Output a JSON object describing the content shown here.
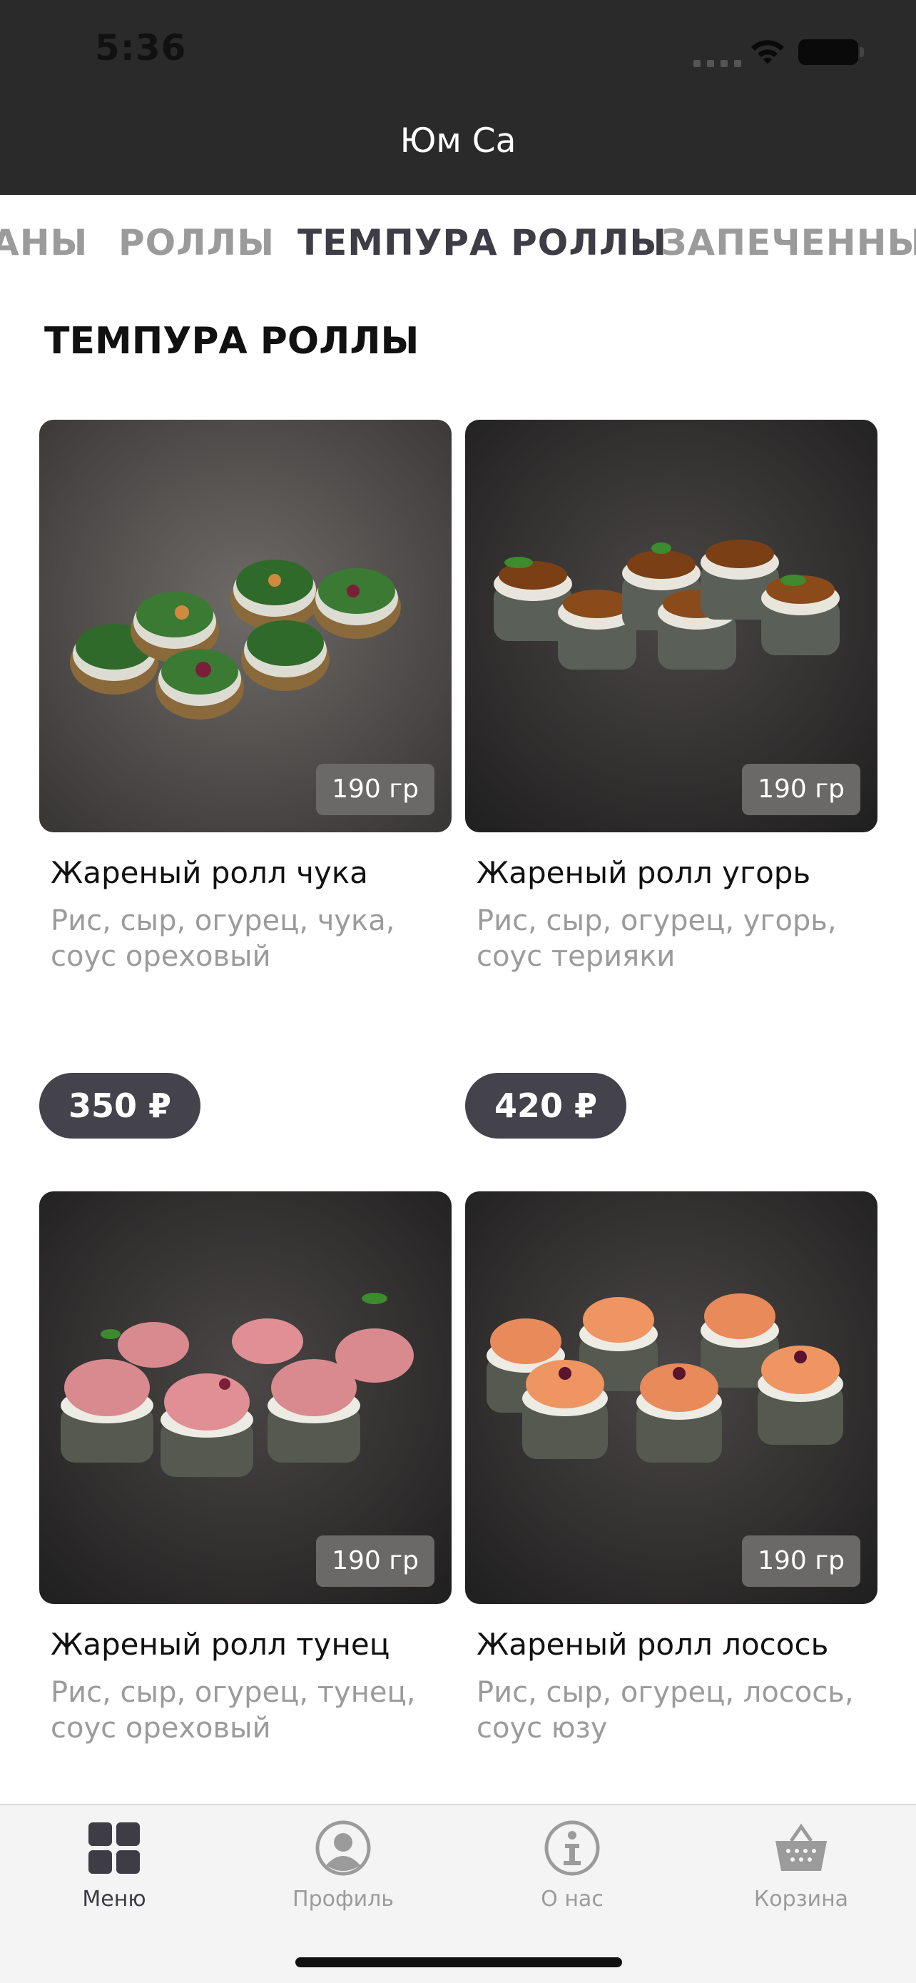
{
  "status_bar": {
    "time": "5:36"
  },
  "nav": {
    "title": "Юм Са"
  },
  "categories": [
    {
      "label": "АНЫ",
      "active": false
    },
    {
      "label": "РОЛЛЫ",
      "active": false
    },
    {
      "label": "ТЕМПУРА РОЛЛЫ",
      "active": true
    },
    {
      "label": "ЗАПЕЧЕННЫЕ",
      "active": false
    }
  ],
  "section": {
    "title": "ТЕМПУРА РОЛЛЫ"
  },
  "products": [
    {
      "name": "Жареный ролл чука",
      "description": "Рис, сыр, огурец, чука, соус ореховый",
      "weight": "190 гр",
      "price": "350 ₽",
      "image": "sushi-chuka-image"
    },
    {
      "name": "Жареный ролл угорь",
      "description": "Рис, сыр, огурец, угорь, соус терияки",
      "weight": "190 гр",
      "price": "420 ₽",
      "image": "sushi-eel-image"
    },
    {
      "name": "Жареный ролл тунец",
      "description": "Рис, сыр, огурец, тунец, соус ореховый",
      "weight": "190 гр",
      "image": "sushi-tuna-image"
    },
    {
      "name": "Жареный ролл лосось",
      "description": "Рис, сыр, огурец, лосось, соус юзу",
      "weight": "190 гр",
      "image": "sushi-salmon-image"
    }
  ],
  "tabbar": [
    {
      "label": "Меню",
      "icon": "grid-icon",
      "active": true
    },
    {
      "label": "Профиль",
      "icon": "profile-icon",
      "active": false
    },
    {
      "label": "О нас",
      "icon": "info-icon",
      "active": false
    },
    {
      "label": "Корзина",
      "icon": "basket-icon",
      "active": false
    }
  ],
  "colors": {
    "header": "#2a2a2a",
    "accent": "#44434b",
    "inactive": "#9b9b9b",
    "weight_badge": "#6b6868"
  }
}
